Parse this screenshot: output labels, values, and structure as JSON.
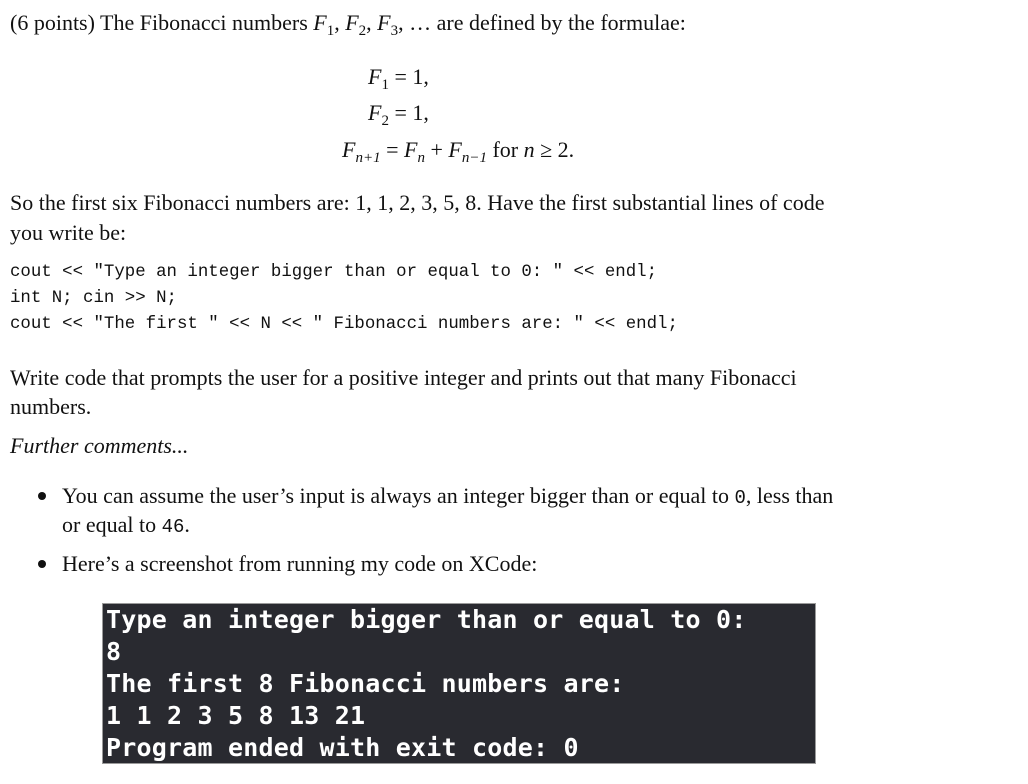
{
  "intro": {
    "prefix": "(6 points) The Fibonacci numbers ",
    "sequence_symbol": "F",
    "subscripts": [
      "1",
      "2",
      "3"
    ],
    "ellipsis": "…",
    "suffix": " are defined by the formulae:"
  },
  "equations": [
    {
      "lhs_symbol": "F",
      "lhs_sub": "1",
      "rhs": "= 1,"
    },
    {
      "lhs_symbol": "F",
      "lhs_sub": "2",
      "rhs": "= 1,"
    },
    {
      "lhs_symbol": "F",
      "lhs_sub": "n+1",
      "rhs_terms": [
        "F",
        "n",
        "F",
        "n−1"
      ],
      "condition_text": "for",
      "condition_var": "n",
      "condition_rel": "≥ 2."
    }
  ],
  "paragraph1": {
    "line1_prefix": "So the first six Fibonacci numbers are:  ",
    "numbers": "1, 1, 2, 3, 5, 8.",
    "line1_suffix": "  Have the first substantial lines of code",
    "line2": "you write be:"
  },
  "code_lines": [
    "cout << \"Type an integer bigger than or equal to 0: \" << endl;",
    "int N; cin >> N;",
    "cout << \"The first \" << N << \" Fibonacci numbers are: \" << endl;"
  ],
  "paragraph2": {
    "line1": "Write code that prompts the user for a positive integer and prints out that many Fibonacci",
    "line2": "numbers."
  },
  "further_comments": "Further comments...",
  "bullets": [
    {
      "line1_prefix": "You can assume the user’s input is always an integer bigger than or equal to ",
      "line1_code": "0",
      "line1_suffix": ", less than",
      "line2_prefix": "or equal to ",
      "line2_code": "46",
      "line2_suffix": "."
    },
    {
      "line1": "Here’s a screenshot from running my code on XCode:"
    }
  ],
  "terminal": {
    "lines": [
      "Type an integer bigger than or equal to 0:",
      "8",
      "The first 8 Fibonacci numbers are:",
      "1 1 2 3 5 8 13 21",
      "Program ended with exit code: 0"
    ],
    "background_color": "#292a30",
    "text_color": "#ffffff"
  }
}
